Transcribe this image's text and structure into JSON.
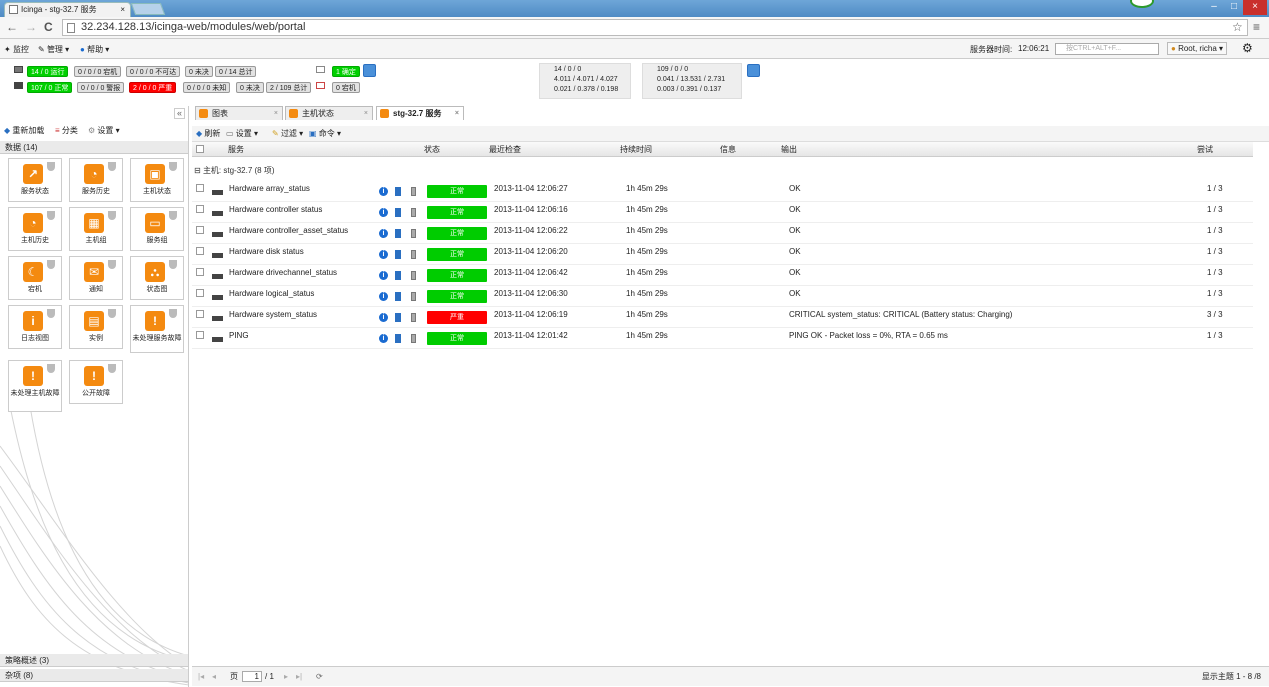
{
  "browser": {
    "tab_title": "Icinga - stg-32.7 服务",
    "tab_close": "×",
    "url": "32.234.128.13/icinga-web/modules/web/portal",
    "back": "←",
    "forward": "→",
    "reload": "C",
    "star": "☆",
    "menu": "≡",
    "min": "–",
    "max": "□",
    "close": "×"
  },
  "menubar": {
    "monitor": "监控",
    "admin": "管理",
    "help": "帮助",
    "server_time_label": "服务器时间:",
    "server_time": "12:06:21",
    "search_placeholder": "按CTRL+ALT+F...",
    "user": "Root, richa"
  },
  "status": {
    "hosts": [
      "14 / 0 运行",
      "0 / 0 / 0 宕机",
      "0 / 0 / 0 不可达",
      "0 未决",
      "0 / 14 总计"
    ],
    "services": [
      "107 / 0 正常",
      "0 / 0 / 0 警报",
      "2 / 0 / 0 严重",
      "0 / 0 / 0 未知",
      "0 未决",
      "2 / 109 总计"
    ],
    "extra1": "1 确定",
    "extra2": "0 宕机",
    "perf_a": [
      "14 / 0 / 0",
      "4.011 / 4.071 / 4.027",
      "0.021 / 0.378 / 0.198"
    ],
    "perf_b": [
      "109 / 0 / 0",
      "0.041 / 13.531 / 2.731",
      "0.003 / 0.391 / 0.137"
    ]
  },
  "sidebar": {
    "reload": "重新加载",
    "categories": "分类",
    "settings": "设置",
    "data_header": "数据 (14)",
    "collapse": "«",
    "tiles": [
      {
        "label": "服务状态",
        "glyph": "↗"
      },
      {
        "label": "服务历史",
        "glyph": "◔"
      },
      {
        "label": "主机状态",
        "glyph": "▣"
      },
      {
        "label": "主机历史",
        "glyph": "◔"
      },
      {
        "label": "主机组",
        "glyph": "▦"
      },
      {
        "label": "服务组",
        "glyph": "▭"
      },
      {
        "label": "宕机",
        "glyph": "☾"
      },
      {
        "label": "通知",
        "glyph": "✉"
      },
      {
        "label": "状态图",
        "glyph": "⛬"
      },
      {
        "label": "日志视图",
        "glyph": "i"
      },
      {
        "label": "实例",
        "glyph": "▤"
      },
      {
        "label": "未处理服务故障",
        "glyph": "!"
      },
      {
        "label": "未处理主机故障",
        "glyph": "!"
      },
      {
        "label": "公开故障",
        "glyph": "!"
      }
    ],
    "footer1": "策略概述 (3)",
    "footer2": "杂项 (8)"
  },
  "tabs": [
    {
      "label": "图表"
    },
    {
      "label": "主机状态"
    },
    {
      "label": "stg-32.7 服务"
    }
  ],
  "toolbar": {
    "refresh": "刷新",
    "settings": "设置",
    "filter": "过滤",
    "command": "命令"
  },
  "columns": {
    "service": "服务",
    "status": "状态",
    "last_check": "最近检查",
    "duration": "持续时间",
    "info": "信息",
    "output": "输出",
    "attempt": "尝试"
  },
  "group_label": "主机: stg-32.7 (8 项)",
  "rows": [
    {
      "service": "Hardware array_status",
      "status": "正常",
      "level": "ok",
      "last_check": "2013-11-04 12:06:27",
      "duration": "1h 45m 29s",
      "output": "OK",
      "attempt": "1 / 3"
    },
    {
      "service": "Hardware controller status",
      "status": "正常",
      "level": "ok",
      "last_check": "2013-11-04 12:06:16",
      "duration": "1h 45m 29s",
      "output": "OK",
      "attempt": "1 / 3"
    },
    {
      "service": "Hardware controller_asset_status",
      "status": "正常",
      "level": "ok",
      "last_check": "2013-11-04 12:06:22",
      "duration": "1h 45m 29s",
      "output": "OK",
      "attempt": "1 / 3"
    },
    {
      "service": "Hardware disk status",
      "status": "正常",
      "level": "ok",
      "last_check": "2013-11-04 12:06:20",
      "duration": "1h 45m 29s",
      "output": "OK",
      "attempt": "1 / 3"
    },
    {
      "service": "Hardware drivechannel_status",
      "status": "正常",
      "level": "ok",
      "last_check": "2013-11-04 12:06:42",
      "duration": "1h 45m 29s",
      "output": "OK",
      "attempt": "1 / 3"
    },
    {
      "service": "Hardware logical_status",
      "status": "正常",
      "level": "ok",
      "last_check": "2013-11-04 12:06:30",
      "duration": "1h 45m 29s",
      "output": "OK",
      "attempt": "1 / 3"
    },
    {
      "service": "Hardware system_status",
      "status": "严重",
      "level": "crit",
      "last_check": "2013-11-04 12:06:19",
      "duration": "1h 45m 29s",
      "output": "CRITICAL system_status: CRITICAL (Battery status: Charging)",
      "attempt": "3 / 3"
    },
    {
      "service": "PING",
      "status": "正常",
      "level": "ok",
      "last_check": "2013-11-04 12:01:42",
      "duration": "1h 45m 29s",
      "output": "PING OK - Packet loss = 0%, RTA = 0.65 ms",
      "attempt": "1 / 3"
    }
  ],
  "pager": {
    "page_label": "页",
    "page": "1",
    "of": "/ 1",
    "display": "显示主题 1 - 8 /8"
  }
}
